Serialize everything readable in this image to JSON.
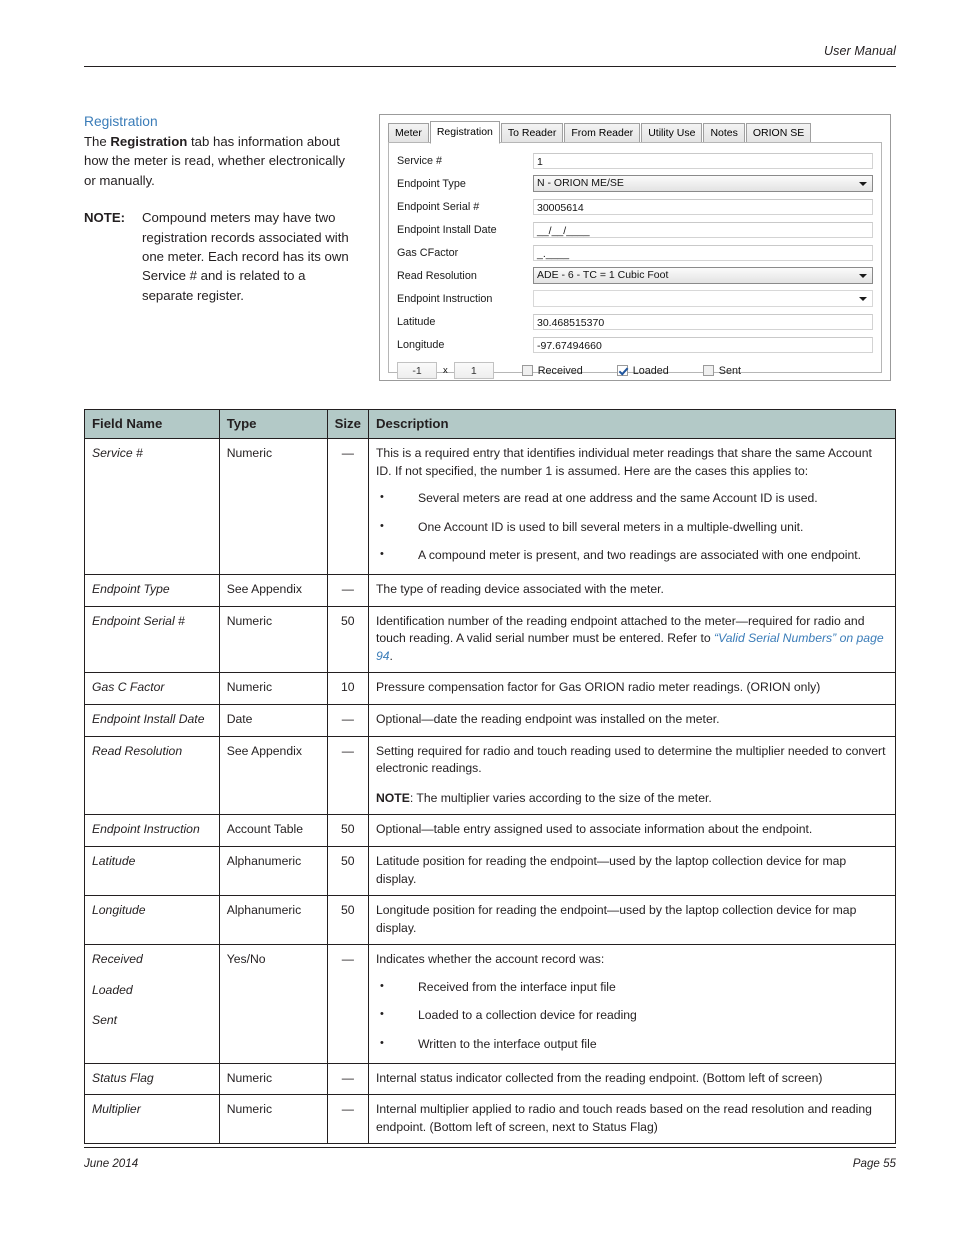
{
  "header": {
    "right_text": "User Manual"
  },
  "footer": {
    "left_text": "June 2014",
    "right_text": "Page 55"
  },
  "intro": {
    "heading": "Registration",
    "paragraph_pre": "The ",
    "paragraph_bold": "Registration",
    "paragraph_post": " tab has information about how the meter is read, whether electronically or manually.",
    "note_label": "NOTE:",
    "note_text": "Compound meters may have two registration records associated with one meter. Each record has its own Service # and is related to a separate register."
  },
  "dialog": {
    "tabs": [
      {
        "label": "Meter",
        "active": false
      },
      {
        "label": "Registration",
        "active": true
      },
      {
        "label": "To Reader",
        "active": false
      },
      {
        "label": "From Reader",
        "active": false
      },
      {
        "label": "Utility Use",
        "active": false
      },
      {
        "label": "Notes",
        "active": false
      },
      {
        "label": "ORION SE",
        "active": false
      }
    ],
    "rows": [
      {
        "label": "Service #",
        "value": "1",
        "kind": "text"
      },
      {
        "label": "Endpoint Type",
        "value": "N - ORION ME/SE",
        "kind": "combo"
      },
      {
        "label": "Endpoint Serial #",
        "value": "30005614",
        "kind": "text"
      },
      {
        "label": "Endpoint Install Date",
        "value": "__/__/____",
        "kind": "text"
      },
      {
        "label": "Gas CFactor",
        "value": "_.____",
        "kind": "text"
      },
      {
        "label": "Read Resolution",
        "value": "ADE - 6 - TC = 1 Cubic Foot",
        "kind": "combo"
      },
      {
        "label": "Endpoint Instruction",
        "value": "",
        "kind": "combo-plain"
      },
      {
        "label": "Latitude",
        "value": "30.468515370",
        "kind": "text"
      },
      {
        "label": "Longitude",
        "value": "-97.67494660",
        "kind": "text"
      }
    ],
    "status_flag": "-1",
    "multiply_sign": "x",
    "multiplier": "1",
    "checkboxes": [
      {
        "label": "Received",
        "checked": false
      },
      {
        "label": "Loaded",
        "checked": true
      },
      {
        "label": "Sent",
        "checked": false
      }
    ]
  },
  "table": {
    "columns": [
      "Field Name",
      "Type",
      "Size",
      "Description"
    ],
    "rows": [
      {
        "field": "Service #",
        "type": "Numeric",
        "size": "—",
        "desc_intro": "This is a required entry that identifies individual meter readings that share the same Account ID. If not specified, the number 1 is assumed. Here are the cases this applies to:",
        "bullets": [
          "Several meters are read at one address and the same Account ID is used.",
          "One Account ID is used to bill several meters in a multiple-dwelling unit.",
          "A compound meter is present, and two readings are associated with one endpoint."
        ]
      },
      {
        "field": "Endpoint Type",
        "type": "See Appendix",
        "size": "—",
        "desc_intro": "The type of reading device associated with the meter."
      },
      {
        "field": "Endpoint Serial #",
        "type": "Numeric",
        "size": "50",
        "desc_pre": "Identification number of the reading endpoint attached to the meter—required for radio and touch reading. A valid serial number must be entered. Refer to ",
        "desc_link": "“Valid Serial Numbers” on page 94",
        "desc_post": "."
      },
      {
        "field": "Gas C Factor",
        "type": "Numeric",
        "size": "10",
        "desc_intro": "Pressure compensation factor for Gas ORION radio meter readings. (ORION only)"
      },
      {
        "field": "Endpoint Install Date",
        "type": "Date",
        "size": "—",
        "desc_intro": "Optional—date the reading endpoint was installed on the meter."
      },
      {
        "field": "Read Resolution",
        "type": "See Appendix",
        "size": "—",
        "desc_intro": "Setting required for radio and touch reading used to determine the multiplier needed to convert electronic readings.",
        "note_bold": "NOTE",
        "note_rest": ": The multiplier varies according to the size of the meter."
      },
      {
        "field": "Endpoint Instruction",
        "type": "Account Table",
        "size": "50",
        "desc_intro": "Optional—table entry assigned used to associate information about the endpoint."
      },
      {
        "field": "Latitude",
        "type": "Alphanumeric",
        "size": "50",
        "desc_intro": "Latitude position for reading the endpoint—used by the laptop collection device for map display."
      },
      {
        "field": "Longitude",
        "type": "Alphanumeric",
        "size": "50",
        "desc_intro": "Longitude position for reading the endpoint—used by the laptop collection device for map display."
      },
      {
        "field_stack": [
          "Received",
          "Loaded",
          "Sent"
        ],
        "type": "Yes/No",
        "size": "—",
        "desc_intro": "Indicates whether the account record was:",
        "bullets": [
          "Received from the interface input file",
          "Loaded to a collection device for reading",
          "Written to the interface output file"
        ]
      },
      {
        "field": "Status Flag",
        "type": "Numeric",
        "size": "—",
        "desc_intro": "Internal status indicator collected from the reading endpoint. (Bottom left of screen)"
      },
      {
        "field": "Multiplier",
        "type": "Numeric",
        "size": "—",
        "desc_intro": "Internal multiplier applied to radio and touch reads based on the read resolution and reading endpoint. (Bottom left of screen, next to Status Flag)"
      }
    ]
  }
}
